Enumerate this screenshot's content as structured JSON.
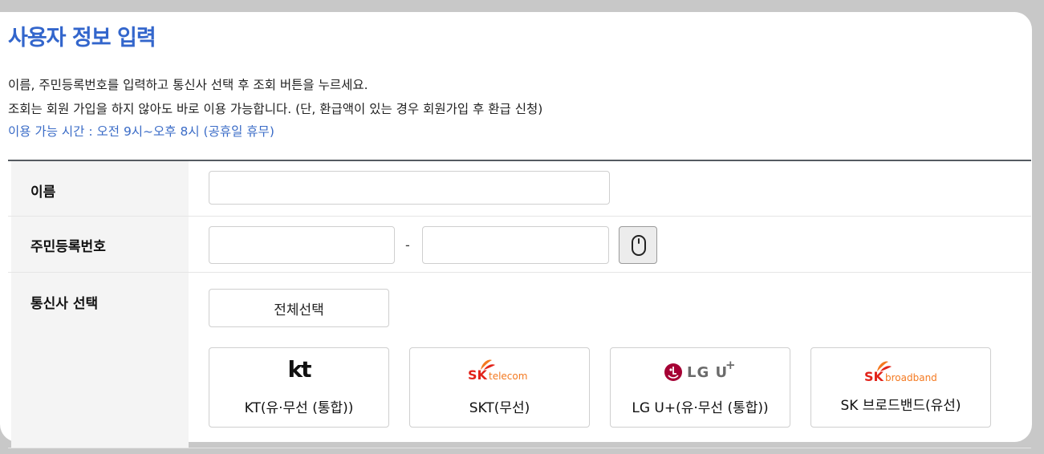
{
  "page": {
    "title": "사용자 정보 입력",
    "desc_line1": "이름, 주민등록번호를 입력하고 통신사 선택 후 조회 버튼을 누르세요.",
    "desc_line2": "조회는 회원 가입을 하지 않아도 바로 이용 가능합니다. (단, 환급액이 있는 경우 회원가입 후 환급 신청)",
    "hours_notice": "이용 가능 시간 : 오전 9시~오후 8시 (공휴일 휴무)"
  },
  "form": {
    "name_label": "이름",
    "name_value": "",
    "rrn_label": "주민등록번호",
    "rrn_first_value": "",
    "rrn_separator": "-",
    "rrn_second_value": "",
    "carrier_label": "통신사 선택",
    "select_all_label": "전체선택",
    "carriers": [
      {
        "name": "KT(유·무선 (통합))",
        "logo_text": "kt",
        "logo_icon": "kt-logo"
      },
      {
        "name": "SKT(무선)",
        "logo_text": "SK",
        "logo_subtext": "telecom",
        "logo_icon": "sk-telecom-logo"
      },
      {
        "name": "LG U+(유·무선 (통합))",
        "logo_text": "LG U",
        "logo_sup": "+",
        "logo_icon": "lg-uplus-logo"
      },
      {
        "name": "SK 브로드밴드(유선)",
        "logo_text": "SK",
        "logo_subtext": "broadband",
        "logo_icon": "sk-broadband-logo"
      }
    ]
  },
  "colors": {
    "accent": "#3366cc",
    "sk_red": "#e2231a",
    "sk_orange": "#f47920",
    "lg_magenta": "#a50034"
  }
}
